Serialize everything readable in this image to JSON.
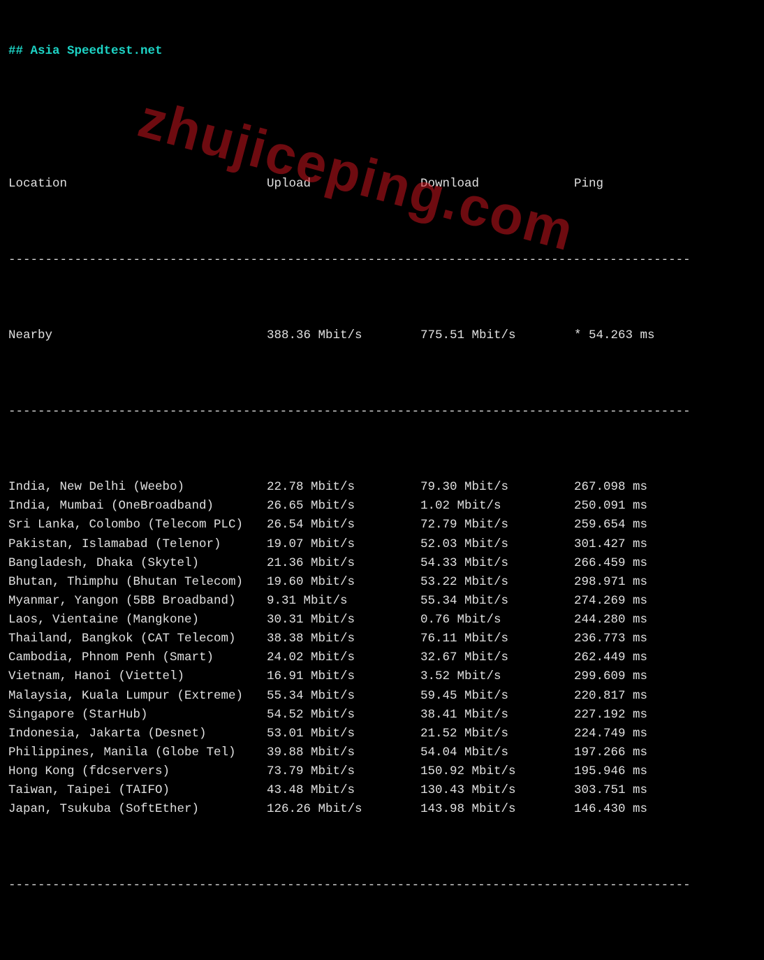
{
  "title": "## Asia Speedtest.net",
  "headers": {
    "location": "Location",
    "upload": "Upload",
    "download": "Download",
    "ping": "Ping"
  },
  "divider": "---------------------------------------------------------------------------------------------",
  "nearby": {
    "location": "Nearby",
    "upload": "388.36 Mbit/s",
    "download": "775.51 Mbit/s",
    "ping": "* 54.263 ms"
  },
  "rows": [
    {
      "location": "India, New Delhi (Weebo)",
      "upload": "22.78 Mbit/s",
      "download": "79.30 Mbit/s",
      "ping": "267.098 ms"
    },
    {
      "location": "India, Mumbai (OneBroadband)",
      "upload": "26.65 Mbit/s",
      "download": "1.02 Mbit/s",
      "ping": "250.091 ms"
    },
    {
      "location": "Sri Lanka, Colombo (Telecom PLC)",
      "upload": "26.54 Mbit/s",
      "download": "72.79 Mbit/s",
      "ping": "259.654 ms"
    },
    {
      "location": "Pakistan, Islamabad (Telenor)",
      "upload": "19.07 Mbit/s",
      "download": "52.03 Mbit/s",
      "ping": "301.427 ms"
    },
    {
      "location": "Bangladesh, Dhaka (Skytel)",
      "upload": "21.36 Mbit/s",
      "download": "54.33 Mbit/s",
      "ping": "266.459 ms"
    },
    {
      "location": "Bhutan, Thimphu (Bhutan Telecom)",
      "upload": "19.60 Mbit/s",
      "download": "53.22 Mbit/s",
      "ping": "298.971 ms"
    },
    {
      "location": "Myanmar, Yangon (5BB Broadband)",
      "upload": "9.31 Mbit/s",
      "download": "55.34 Mbit/s",
      "ping": "274.269 ms"
    },
    {
      "location": "Laos, Vientaine (Mangkone)",
      "upload": "30.31 Mbit/s",
      "download": "0.76 Mbit/s",
      "ping": "244.280 ms"
    },
    {
      "location": "Thailand, Bangkok (CAT Telecom)",
      "upload": "38.38 Mbit/s",
      "download": "76.11 Mbit/s",
      "ping": "236.773 ms"
    },
    {
      "location": "Cambodia, Phnom Penh (Smart)",
      "upload": "24.02 Mbit/s",
      "download": "32.67 Mbit/s",
      "ping": "262.449 ms"
    },
    {
      "location": "Vietnam, Hanoi (Viettel)",
      "upload": "16.91 Mbit/s",
      "download": "3.52 Mbit/s",
      "ping": "299.609 ms"
    },
    {
      "location": "Malaysia, Kuala Lumpur (Extreme)",
      "upload": "55.34 Mbit/s",
      "download": "59.45 Mbit/s",
      "ping": "220.817 ms"
    },
    {
      "location": "Singapore (StarHub)",
      "upload": "54.52 Mbit/s",
      "download": "38.41 Mbit/s",
      "ping": "227.192 ms"
    },
    {
      "location": "Indonesia, Jakarta (Desnet)",
      "upload": "53.01 Mbit/s",
      "download": "21.52 Mbit/s",
      "ping": "224.749 ms"
    },
    {
      "location": "Philippines, Manila (Globe Tel)",
      "upload": "39.88 Mbit/s",
      "download": "54.04 Mbit/s",
      "ping": "197.266 ms"
    },
    {
      "location": "Hong Kong (fdcservers)",
      "upload": "73.79 Mbit/s",
      "download": "150.92 Mbit/s",
      "ping": "195.946 ms"
    },
    {
      "location": "Taiwan, Taipei (TAIFO)",
      "upload": "43.48 Mbit/s",
      "download": "130.43 Mbit/s",
      "ping": "303.751 ms"
    },
    {
      "location": "Japan, Tsukuba (SoftEther)",
      "upload": "126.26 Mbit/s",
      "download": "143.98 Mbit/s",
      "ping": "146.430 ms"
    }
  ],
  "watermark": "zhujiceping.com"
}
